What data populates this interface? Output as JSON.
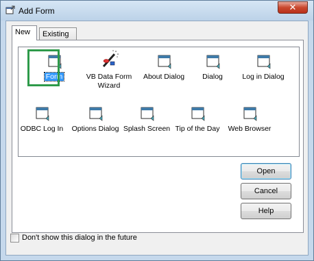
{
  "window": {
    "title": "Add Form",
    "close_glyph": "✕"
  },
  "tabs": [
    {
      "label": "New",
      "active": true
    },
    {
      "label": "Existing",
      "active": false
    }
  ],
  "items": [
    {
      "label": "Form",
      "icon": "form-icon",
      "selected": true
    },
    {
      "label": "VB Data Form Wizard",
      "icon": "wizard-icon",
      "selected": false
    },
    {
      "label": "About Dialog",
      "icon": "form-icon",
      "selected": false
    },
    {
      "label": "Dialog",
      "icon": "form-icon",
      "selected": false
    },
    {
      "label": "Log in Dialog",
      "icon": "form-icon",
      "selected": false
    },
    {
      "label": "ODBC Log In",
      "icon": "form-icon",
      "selected": false
    },
    {
      "label": "Options Dialog",
      "icon": "form-icon",
      "selected": false
    },
    {
      "label": "Splash Screen",
      "icon": "form-icon",
      "selected": false
    },
    {
      "label": "Tip of the Day",
      "icon": "form-icon",
      "selected": false
    },
    {
      "label": "Web Browser",
      "icon": "form-icon",
      "selected": false
    }
  ],
  "wizard_label_lines": [
    "VB Data Form",
    "Wizard"
  ],
  "buttons": {
    "open": "Open",
    "cancel": "Cancel",
    "help": "Help"
  },
  "checkbox": {
    "label": "Don't show this dialog in the future",
    "checked": false
  },
  "colors": {
    "selection": "#3399ff",
    "highlight_box": "#2e9a4a"
  }
}
